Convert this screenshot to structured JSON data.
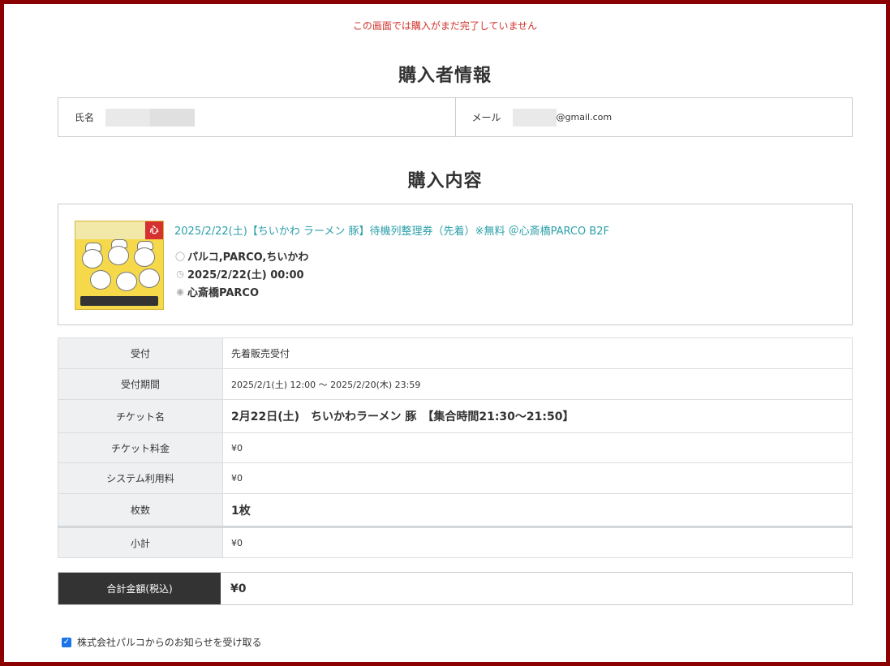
{
  "notice": "この画面では購入がまだ完了していません",
  "buyer": {
    "section_title": "購入者情報",
    "name_label": "氏名",
    "email_label": "メール",
    "email_suffix": "@gmail.com"
  },
  "purchase": {
    "section_title": "購入内容",
    "event": {
      "thumb_badge": "心",
      "title": "2025/2/22(土)【ちいかわ ラーメン 豚】待機列整理券（先着）※無料 ＠心斎橋PARCO B2F",
      "organizer": "パルコ,PARCO,ちいかわ",
      "datetime": "2025/2/22(土) 00:00",
      "venue": "心斎橋PARCO",
      "icons": [
        "person-icon",
        "clock-icon",
        "location-pin-icon"
      ]
    },
    "rows": [
      {
        "label": "受付",
        "value": "先着販売受付"
      },
      {
        "label": "受付期間",
        "value": "2025/2/1(土) 12:00 〜 2025/2/20(木) 23:59"
      },
      {
        "label": "チケット名",
        "value": "2月22日(土)　ちいかわラーメン 豚　【集合時間21:30〜21:50】"
      },
      {
        "label": "チケット料金",
        "value": "¥0"
      },
      {
        "label": "システム利用料",
        "value": "¥0"
      },
      {
        "label": "枚数",
        "value": "1枚"
      },
      {
        "label": "小計",
        "value": "¥0"
      }
    ],
    "total": {
      "label": "合計金額(税込)",
      "value": "¥0"
    }
  },
  "consent": {
    "label": "株式会社パルコからのお知らせを受け取る",
    "checked": true
  },
  "colors": {
    "frame": "#8b0000",
    "notice": "#d0342c",
    "link": "#2a9fa8",
    "total_bg": "#333333",
    "checkbox": "#1a73e8"
  }
}
